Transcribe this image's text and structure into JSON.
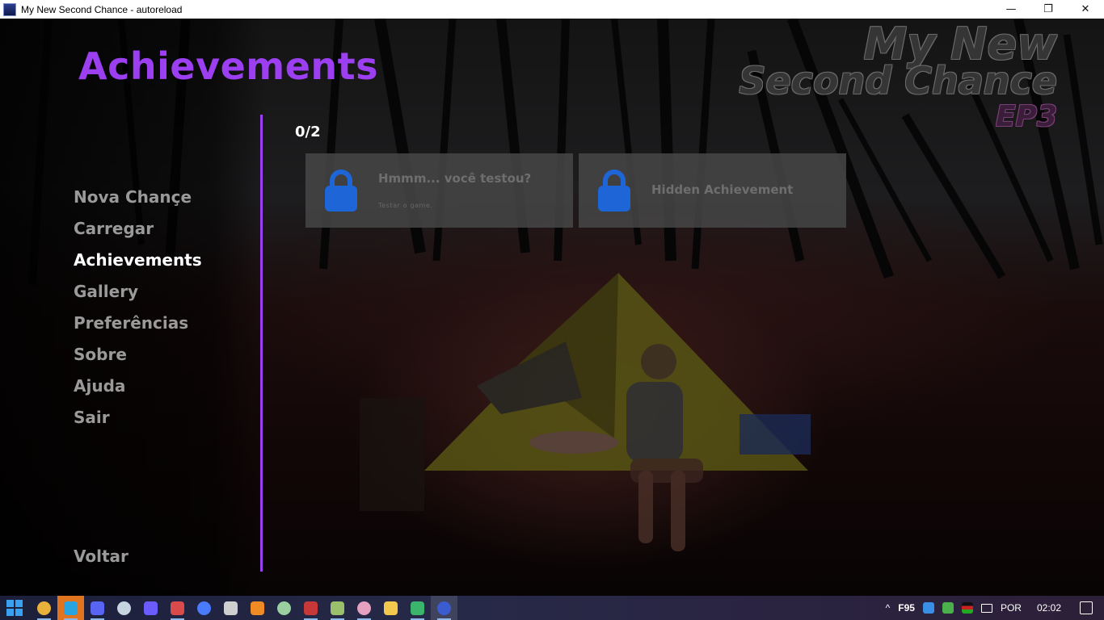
{
  "window": {
    "title": "My New Second Chance - autoreload",
    "minimize": "—",
    "restore": "❐",
    "close": "✕"
  },
  "game": {
    "screen_title": "Achievements",
    "menu": [
      {
        "label": "Nova Chançe",
        "active": false
      },
      {
        "label": "Carregar",
        "active": false
      },
      {
        "label": "Achievements",
        "active": true
      },
      {
        "label": "Gallery",
        "active": false
      },
      {
        "label": "Preferências",
        "active": false
      },
      {
        "label": "Sobre",
        "active": false
      },
      {
        "label": "Ajuda",
        "active": false
      },
      {
        "label": "Sair",
        "active": false
      }
    ],
    "back_label": "Voltar",
    "counter": "0/2",
    "achievements": [
      {
        "name": "Hmmm... você testou?",
        "description": "Testar o game.",
        "locked": true
      },
      {
        "name": "Hidden Achievement",
        "description": "",
        "locked": true
      }
    ],
    "logo": {
      "line1": "My New",
      "line2": "Second Chance",
      "episode": "EP3"
    },
    "colors": {
      "accent": "#9b3ff0",
      "lock": "#1e66d8",
      "card": "#464646"
    }
  },
  "taskbar": {
    "apps": [
      {
        "icon": "chrome-icon",
        "color": "#e8b13a"
      },
      {
        "icon": "telegram-icon",
        "color": "#2aa4e0"
      },
      {
        "icon": "discord-icon",
        "color": "#5865f2"
      },
      {
        "icon": "steam-icon",
        "color": "#c7d5e0"
      },
      {
        "icon": "media-icon",
        "color": "#6a5cff"
      },
      {
        "icon": "racing-icon",
        "color": "#d94b4b"
      },
      {
        "icon": "audio-icon",
        "color": "#4a7bff"
      },
      {
        "icon": "obs-icon",
        "color": "#cfcfcf"
      },
      {
        "icon": "cloud-icon",
        "color": "#f08a24"
      },
      {
        "icon": "monitor-icon",
        "color": "#9ad0a0"
      },
      {
        "icon": "f95-icon",
        "color": "#c93838"
      },
      {
        "icon": "tree-icon",
        "color": "#9bbf6a"
      },
      {
        "icon": "anime-icon",
        "color": "#e6a0c0"
      },
      {
        "icon": "folder-icon",
        "color": "#f2c94c"
      },
      {
        "icon": "globe-icon",
        "color": "#3bb56b"
      },
      {
        "icon": "game-icon",
        "color": "#3b5bd1"
      }
    ],
    "tray": {
      "chevron": "^",
      "f95": "F95",
      "language": "POR",
      "time": "02:02"
    }
  }
}
